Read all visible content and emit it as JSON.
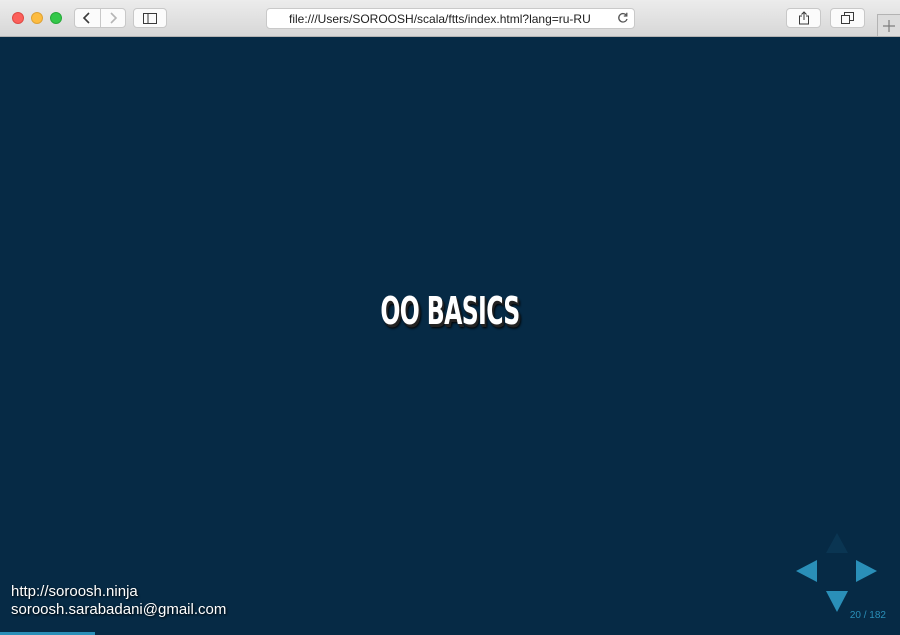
{
  "browser": {
    "url": "file:///Users/SOROOSH/scala/ftts/index.html?lang=ru-RU",
    "icons": {
      "back": "chevron-left-icon",
      "forward": "chevron-right-icon",
      "sidebar": "sidebar-icon",
      "reload": "reload-icon",
      "share": "share-icon",
      "tabs": "tabs-overview-icon",
      "new_tab": "plus-icon"
    }
  },
  "slide": {
    "title": "OO BASICS",
    "footer": {
      "site": "http://soroosh.ninja",
      "email": "soroosh.sarabadani@gmail.com"
    },
    "slide_number": "20 / 182",
    "progress": 0.105
  },
  "colors": {
    "slide_background": "#062a45",
    "accent": "#2a8fb8",
    "title_text": "#ffffff"
  }
}
